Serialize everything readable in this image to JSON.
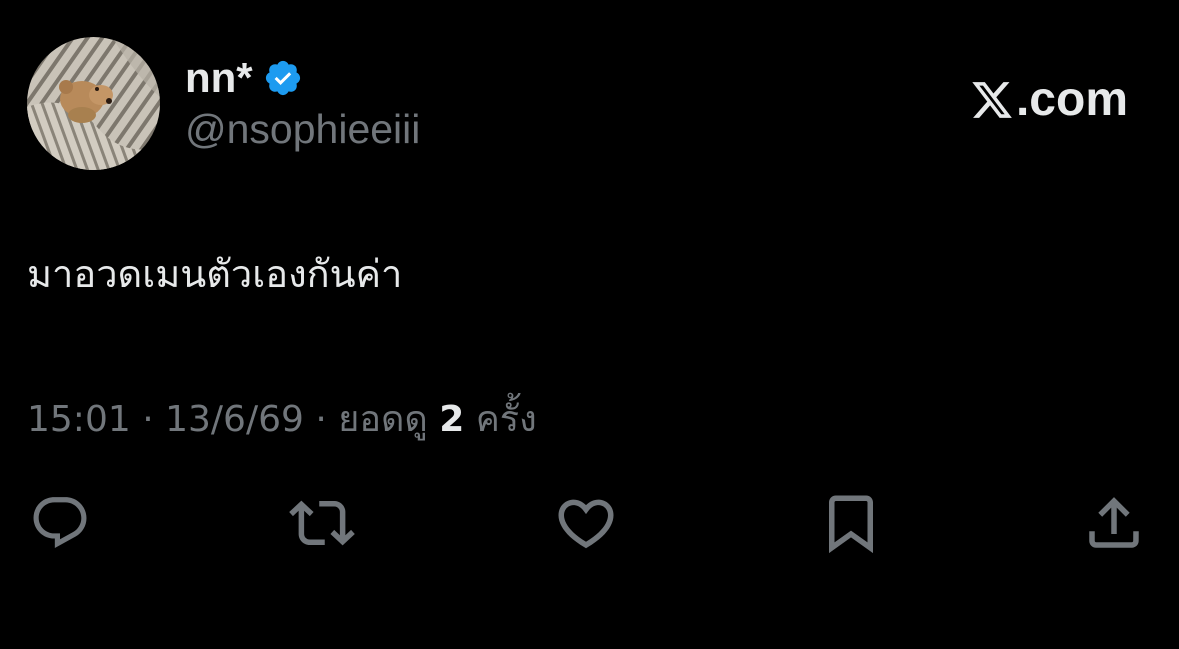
{
  "author": {
    "display_name": "nn*",
    "handle": "@nsophieeiii",
    "verified": true,
    "avatar_icon": "teddy-bear-avatar"
  },
  "brand": {
    "text": ".com",
    "logo_icon": "x-logo-icon"
  },
  "tweet": {
    "text": "มาอวดเมนตัวเองกันค่า"
  },
  "meta": {
    "time": "15:01",
    "date": "13/6/69",
    "separator": "·",
    "views_label": "ยอดดู",
    "views_count": "2",
    "views_unit": "ครั้ง"
  },
  "actions": [
    {
      "name": "reply",
      "icon": "reply-icon"
    },
    {
      "name": "retweet",
      "icon": "retweet-icon"
    },
    {
      "name": "like",
      "icon": "heart-icon"
    },
    {
      "name": "bookmark",
      "icon": "bookmark-icon"
    },
    {
      "name": "share",
      "icon": "share-icon"
    }
  ],
  "colors": {
    "background": "#000000",
    "text_primary": "#e7e9ea",
    "text_secondary": "#71767b",
    "verified_blue": "#1d9bf0"
  }
}
